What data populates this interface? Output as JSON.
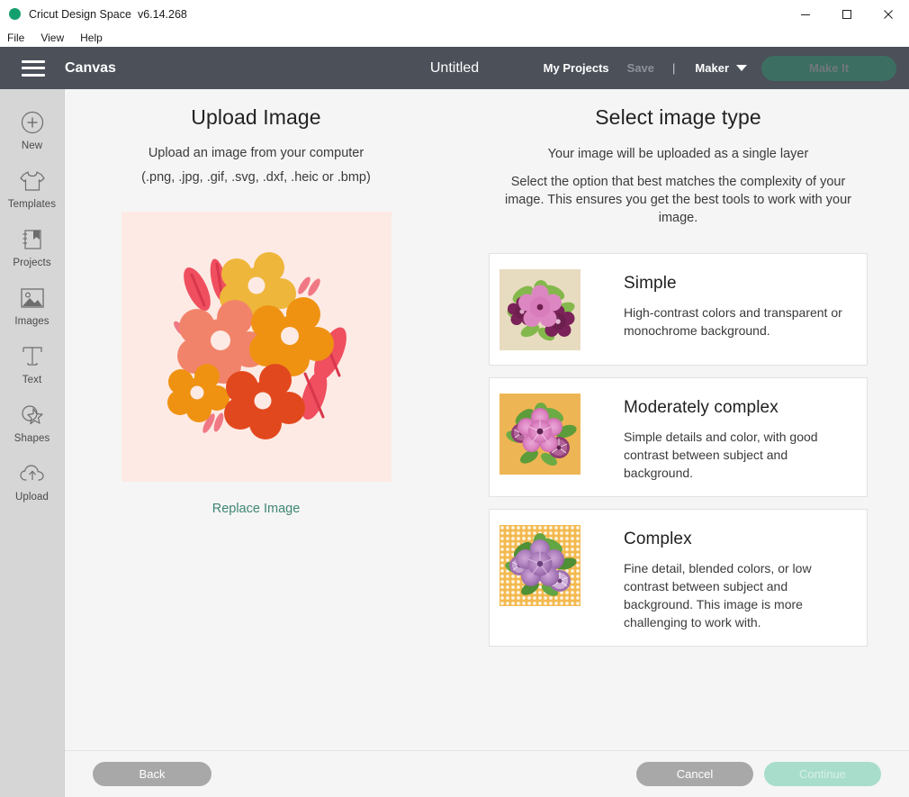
{
  "window": {
    "app_name": "Cricut Design Space",
    "version": "v6.14.268",
    "minimize": "minimize-icon",
    "maximize": "maximize-icon",
    "close": "close-icon",
    "accent_green": "#14a06e"
  },
  "menubar": {
    "items": [
      "File",
      "View",
      "Help"
    ]
  },
  "header": {
    "menu_icon": "hamburger-icon",
    "canvas_label": "Canvas",
    "document_title": "Untitled",
    "my_projects": "My Projects",
    "save": "Save",
    "divider": "|",
    "machine": "Maker",
    "machine_chevron": "chevron-down-icon",
    "make_it": "Make It",
    "bg_color": "#4b5059",
    "make_it_color": "#3c6e62"
  },
  "sidebar": {
    "items": [
      {
        "label": "New",
        "icon": "plus-circle-icon"
      },
      {
        "label": "Templates",
        "icon": "tshirt-icon"
      },
      {
        "label": "Projects",
        "icon": "book-bookmark-icon"
      },
      {
        "label": "Images",
        "icon": "picture-icon"
      },
      {
        "label": "Text",
        "icon": "text-t-icon"
      },
      {
        "label": "Shapes",
        "icon": "shapes-icon"
      },
      {
        "label": "Upload",
        "icon": "upload-cloud-icon"
      }
    ]
  },
  "upload_panel": {
    "title": "Upload Image",
    "line1": "Upload an image from your computer",
    "line2": "(.png, .jpg, .gif, .svg, .dxf, .heic or .bmp)",
    "preview_bg": "#fdeae4",
    "preview_alt": "flowers-illustration",
    "replace_label": "Replace Image",
    "replace_color": "#3f8574"
  },
  "image_type_panel": {
    "title": "Select image type",
    "subtitle": "Your image will be uploaded as a single layer",
    "description": "Select the option that best matches the complexity of your image. This ensures you get the best tools to work with your image.",
    "options": [
      {
        "label": "Simple",
        "description": "High-contrast colors and transparent or monochrome background.",
        "thumb_bg": "#e8dcc0",
        "thumb_alt": "simple-flowers-thumbnail"
      },
      {
        "label": "Moderately complex",
        "description": "Simple details and color, with good contrast between subject and background.",
        "thumb_bg": "#eeb554",
        "thumb_alt": "moderately-complex-flowers-thumbnail"
      },
      {
        "label": "Complex",
        "description": "Fine detail, blended colors, or low contrast between subject and background. This image is more challenging to work with.",
        "thumb_bg": "#f3b94f",
        "thumb_alt": "complex-flowers-thumbnail"
      }
    ]
  },
  "footer": {
    "back": "Back",
    "cancel": "Cancel",
    "continue": "Continue",
    "back_color": "#a8a8a8",
    "cancel_color": "#a8a8a8",
    "continue_color": "#a8ddcc"
  }
}
